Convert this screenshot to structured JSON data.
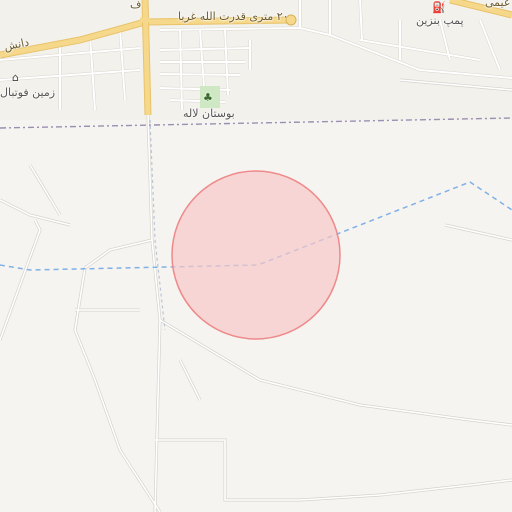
{
  "labels": {
    "main_road": "۲۰ متری قدرت الله غربا",
    "road_left": "دانش",
    "road_top_right": "عیمی",
    "gas_station": "پمپ بنزین",
    "park": "بوستان لاله",
    "football_field": "زمین فوتبال",
    "road_top_small": "ف"
  },
  "icons": {
    "gas_station": "fuel-pump-icon",
    "park": "tree-icon",
    "football_field": "stadium-icon"
  },
  "colors": {
    "background": "#f6f4f1",
    "major_road": "#f6d88a",
    "major_road_casing": "#e8c26a",
    "minor_road": "#ffffff",
    "minor_road_casing": "#d6d2cc",
    "boundary": "#9a8fb0",
    "route_line": "#7fb0e6",
    "circle_fill": "#f7c8c8",
    "circle_stroke": "#ee8a8a",
    "park_green": "#cfe8c4"
  }
}
